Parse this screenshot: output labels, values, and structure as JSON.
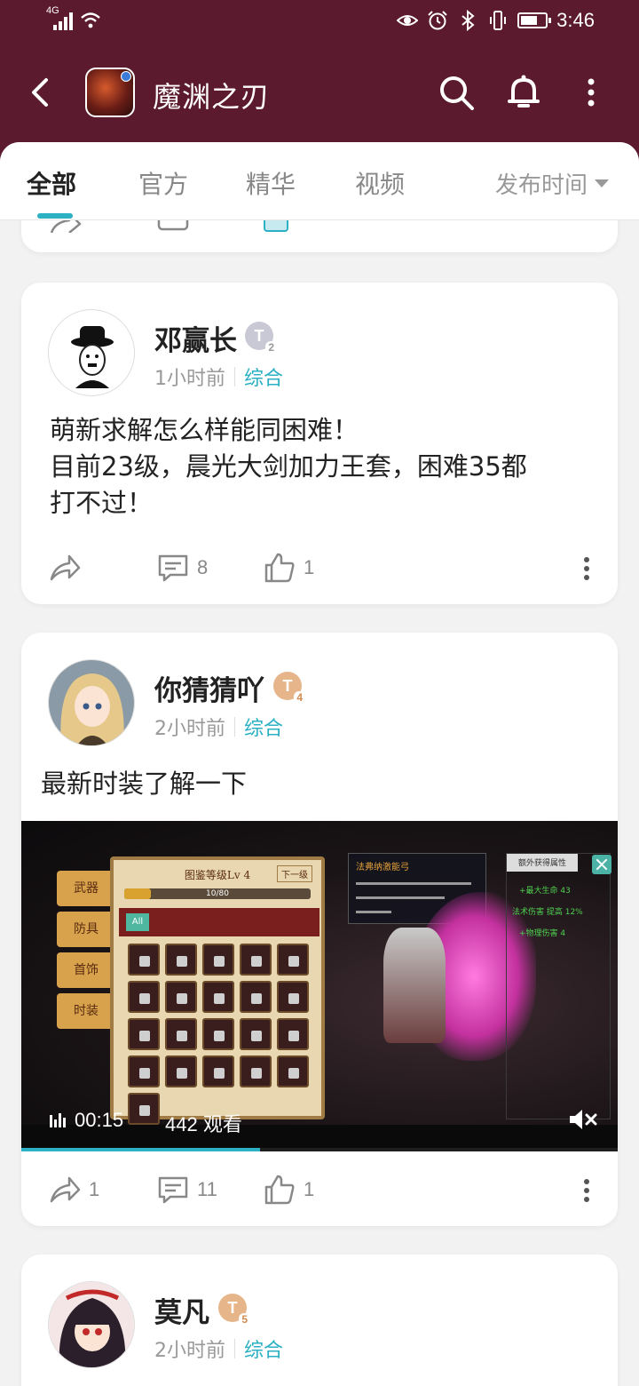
{
  "status_bar": {
    "network": "4G",
    "time": "3:46"
  },
  "header": {
    "app_name": "魔渊之刃"
  },
  "tabs": {
    "items": [
      {
        "label": "全部",
        "active": true
      },
      {
        "label": "官方",
        "active": false
      },
      {
        "label": "精华",
        "active": false
      },
      {
        "label": "视频",
        "active": false
      }
    ],
    "sort_label": "发布时间"
  },
  "posts": [
    {
      "username": "邓赢长",
      "badge": {
        "letter": "T",
        "level": "2",
        "color": "#c9c9d6"
      },
      "time": "1小时前",
      "category": "综合",
      "text": "萌新求解怎么样能同困难！\n目前23级，晨光大剑加力王套，困难35都\n打不过！",
      "share_count": "",
      "comment_count": "8",
      "like_count": "1"
    },
    {
      "username": "你猜猜吖",
      "badge": {
        "letter": "T",
        "level": "4",
        "color": "#e7b58a"
      },
      "time": "2小时前",
      "category": "综合",
      "text": "最新时装了解一下",
      "video": {
        "duration": "00:15",
        "views": "442 观看",
        "progress": 0.4,
        "game_labels": {
          "panel_title": "图鉴等级Lv 4",
          "next_button": "下一级",
          "progress_text": "10/80",
          "tab_all": "All",
          "side_tabs": [
            "武器",
            "防具",
            "首饰",
            "时装"
          ],
          "popup_title": "法弗纳激能弓",
          "stats_title": "额外获得属性",
          "stats": [
            "+最大生命 43",
            "法术伤害 提高 12%",
            "+物理伤害 4"
          ]
        }
      },
      "share_count": "1",
      "comment_count": "11",
      "like_count": "1"
    },
    {
      "username": "莫凡",
      "badge": {
        "letter": "T",
        "level": "5",
        "color": "#e7b58a"
      },
      "time": "2小时前",
      "category": "综合"
    }
  ],
  "colors": {
    "header_bg": "#5b1a2e",
    "accent": "#2bb0c4"
  }
}
